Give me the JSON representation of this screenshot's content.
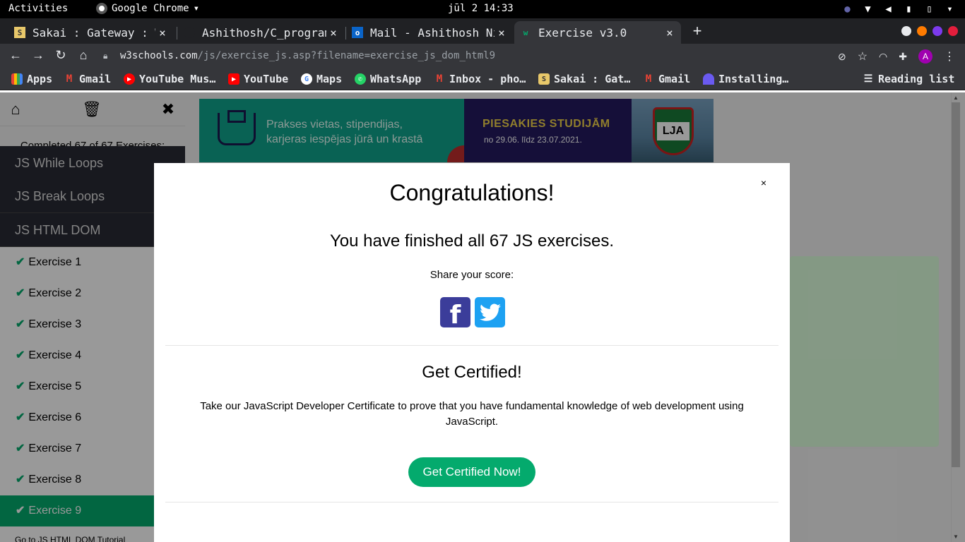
{
  "system_bar": {
    "activities": "Activities",
    "app_name": "Google Chrome",
    "clock": "jūl 2  14:33"
  },
  "tabs": [
    {
      "title": "Sakai : Gateway : We",
      "active": false
    },
    {
      "title": "Ashithosh/C_programm",
      "active": false
    },
    {
      "title": "Mail - Ashithosh Ni",
      "active": false
    },
    {
      "title": "Exercise v3.0",
      "active": true
    }
  ],
  "toolbar": {
    "url_domain": "w3schools.com",
    "url_path": "/js/exercise_js.asp?filename=exercise_js_dom_html9",
    "avatar_letter": "A"
  },
  "bookmarks": [
    {
      "label": "Apps",
      "icon": "apps-grid-icon"
    },
    {
      "label": "Gmail",
      "icon": "gmail-icon"
    },
    {
      "label": "YouTube Mus…",
      "icon": "youtube-music-icon"
    },
    {
      "label": "YouTube",
      "icon": "youtube-icon"
    },
    {
      "label": "Maps",
      "icon": "google-maps-icon"
    },
    {
      "label": "WhatsApp",
      "icon": "whatsapp-icon"
    },
    {
      "label": "Inbox - pho…",
      "icon": "gmail-icon"
    },
    {
      "label": "Sakai : Gat…",
      "icon": "sakai-icon"
    },
    {
      "label": "Gmail",
      "icon": "gmail-icon"
    },
    {
      "label": "Installing…",
      "icon": "installing-icon"
    }
  ],
  "reading_list": "Reading list",
  "sidebar": {
    "completed": "Completed 67 of 67 Exercises:",
    "sections": [
      "JS While Loops",
      "JS Break Loops",
      "JS HTML DOM"
    ],
    "exercises": [
      "Exercise 1",
      "Exercise 2",
      "Exercise 3",
      "Exercise 4",
      "Exercise 5",
      "Exercise 6",
      "Exercise 7",
      "Exercise 8",
      "Exercise 9"
    ],
    "active_exercise": "Exercise 9",
    "tutorial_link": "Go to JS HTML DOM Tutorial"
  },
  "ad": {
    "left_text_line1": "Prakses vietas, stipendijas,",
    "left_text_line2": "karjeras iespējas jūrā un krastā",
    "title": "PIESAKIES STUDIJĀM",
    "dates": "no 29.06. līdz 23.07.2021.",
    "logo_text": "LJA"
  },
  "modal": {
    "close": "×",
    "title": "Congratulations!",
    "finished": "You have finished all 67 JS exercises.",
    "share": "Share your score:",
    "cert_title": "Get Certified!",
    "cert_desc": "Take our JavaScript Developer Certificate to prove that you have fundamental knowledge of web development using JavaScript.",
    "cert_button": "Get Certified Now!"
  },
  "colors": {
    "accent_green": "#04aa6d",
    "sidebar_dark": "#282a35",
    "chrome_dark": "#202124"
  }
}
